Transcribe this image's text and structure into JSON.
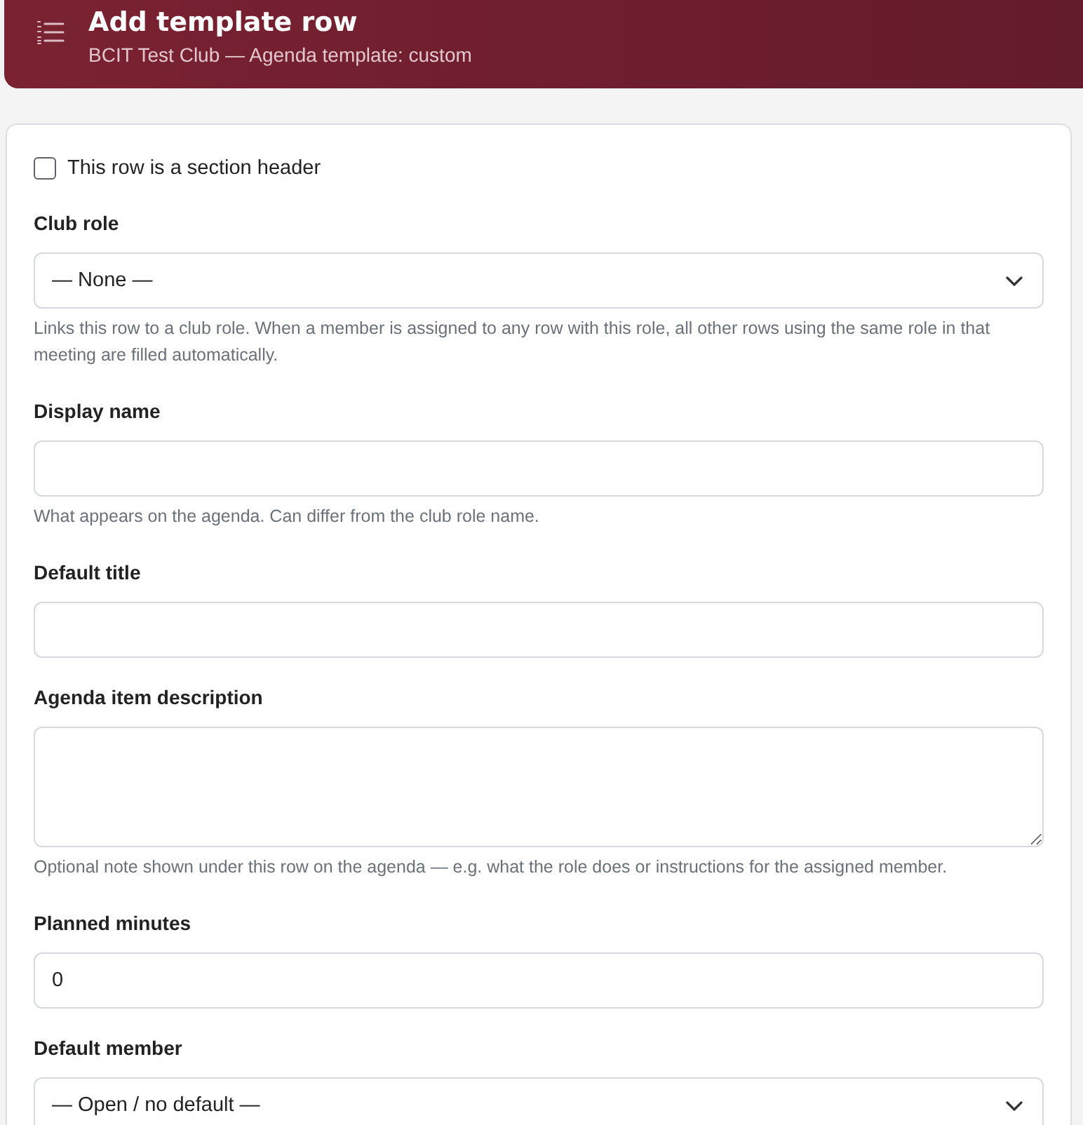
{
  "header": {
    "title": "Add template row",
    "subtitle": "BCIT Test Club — Agenda template: custom"
  },
  "section_header_checkbox": {
    "label": "This row is a section header",
    "checked": false
  },
  "fields": [
    {
      "kind": "select",
      "label": "Club role",
      "value": "— None —",
      "help": "Links this row to a club role. When a member is assigned to any row with this role, all other rows using the same role in that meeting are filled automatically."
    },
    {
      "kind": "text",
      "label": "Display name",
      "help": "What appears on the agenda. Can differ from the club role name."
    },
    {
      "kind": "text",
      "label": "Default title"
    },
    {
      "kind": "textarea",
      "label": "Agenda item description",
      "help": "Optional note shown under this row on the agenda — e.g. what the role does or instructions for the assigned member."
    },
    {
      "kind": "number",
      "label": "Planned minutes",
      "value": "0"
    },
    {
      "kind": "select",
      "label": "Default member",
      "value": "— Open / no default —"
    }
  ]
}
